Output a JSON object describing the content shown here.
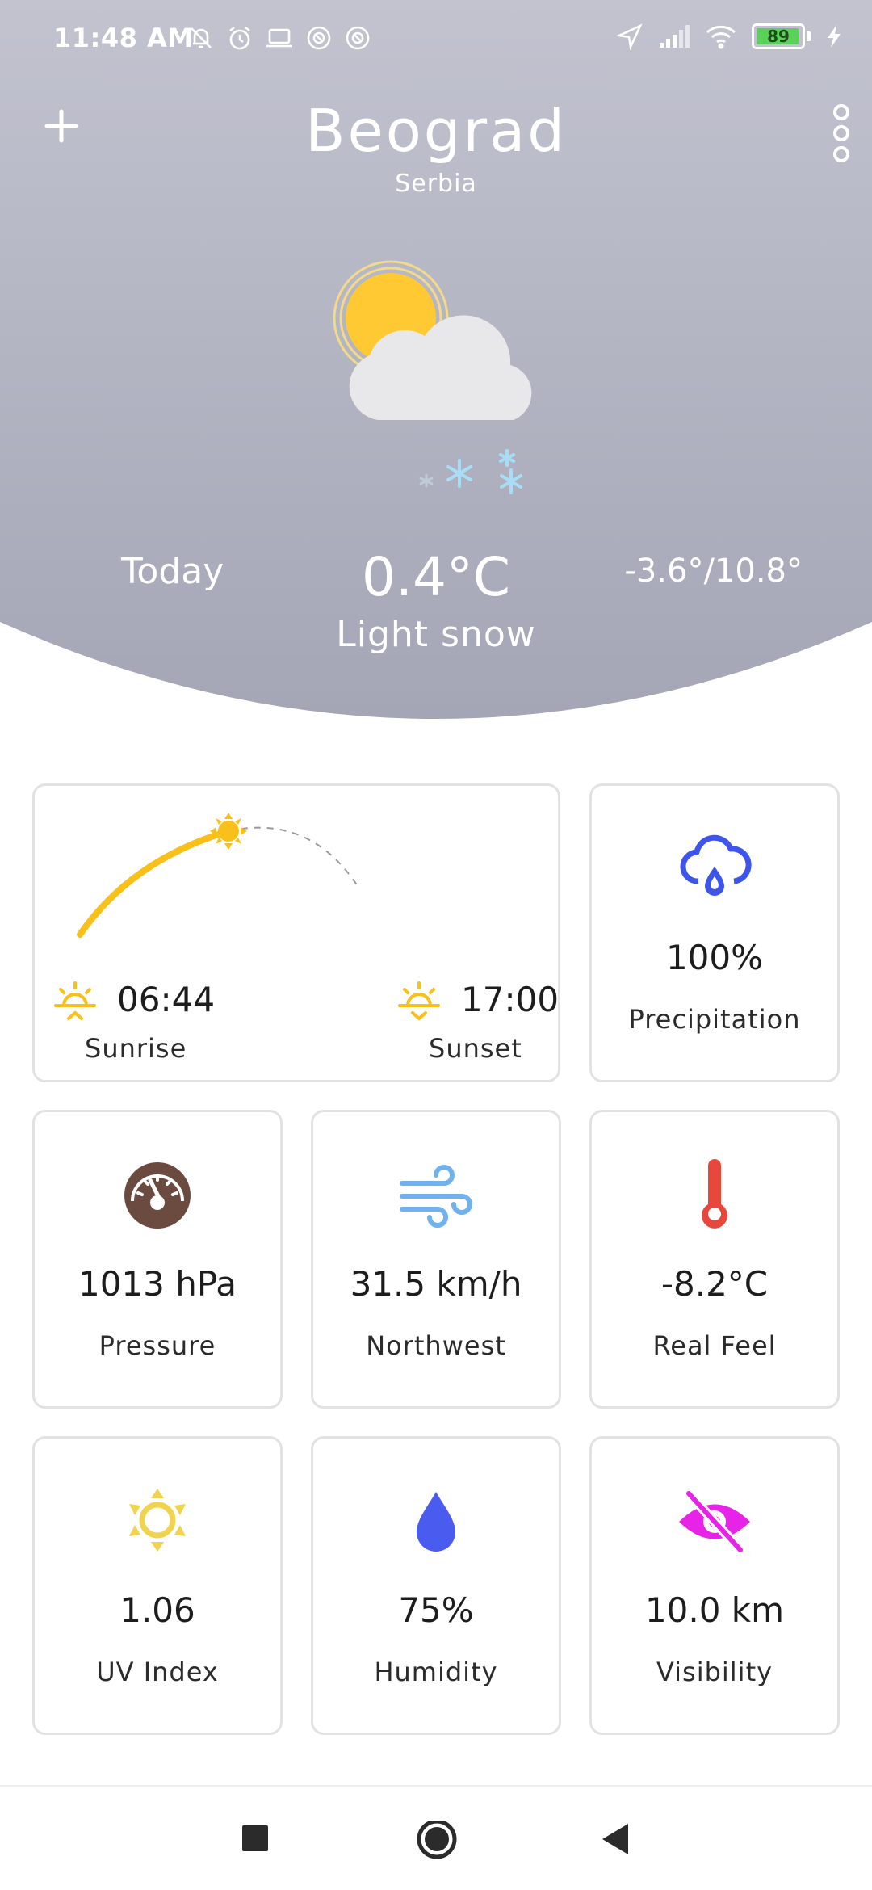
{
  "status_bar": {
    "time": "11:48 AM",
    "battery": "89",
    "icons_left": [
      "mute-icon",
      "alarm-icon",
      "laptop-icon",
      "dnd-icon",
      "dnd-icon"
    ],
    "icons_right": [
      "location-icon",
      "signal-icon",
      "wifi-icon",
      "battery-icon",
      "charging-icon"
    ]
  },
  "header": {
    "city": "Beograd",
    "country": "Serbia",
    "add_icon": "plus-icon",
    "menu_icon": "more-vert-icon"
  },
  "current": {
    "day_label": "Today",
    "temperature": "0.4°C",
    "condition": "Light snow",
    "range": "-3.6°/10.8°",
    "icon": "sun-cloud-snow-icon"
  },
  "sun": {
    "sunrise_time": "06:44",
    "sunrise_label": "Sunrise",
    "sunset_time": "17:00",
    "sunset_label": "Sunset"
  },
  "cards": {
    "precipitation": {
      "value": "100%",
      "label": "Precipitation",
      "icon": "cloud-rain-icon",
      "color": "#3d55e8"
    },
    "pressure": {
      "value": "1013 hPa",
      "label": "Pressure",
      "icon": "gauge-icon",
      "color": "#6b4a3f"
    },
    "wind": {
      "value": "31.5 km/h",
      "label": "Northwest",
      "icon": "wind-icon",
      "color": "#6fb2ee"
    },
    "real_feel": {
      "value": "-8.2°C",
      "label": "Real Feel",
      "icon": "thermometer-icon",
      "color": "#e8473b"
    },
    "uv": {
      "value": "1.06",
      "label": "UV Index",
      "icon": "sun-icon",
      "color": "#f0d34e"
    },
    "humidity": {
      "value": "75%",
      "label": "Humidity",
      "icon": "drop-icon",
      "color": "#4a5cf0"
    },
    "visibility": {
      "value": "10.0 km",
      "label": "Visibility",
      "icon": "eye-off-icon",
      "color": "#e623e6"
    }
  },
  "colors": {
    "header_top": "#c0c1ce",
    "header_bottom": "#a6a8b8",
    "sun": "#ffc933",
    "arc": "#f9c019"
  },
  "nav": {
    "recents_icon": "square-icon",
    "home_icon": "circle-icon",
    "back_icon": "back-triangle-icon"
  }
}
